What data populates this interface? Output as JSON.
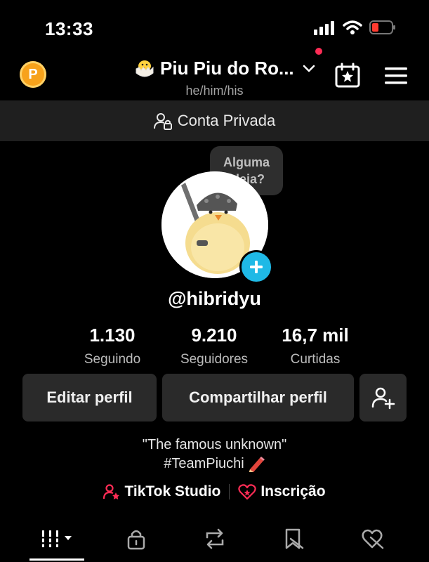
{
  "status_bar": {
    "time": "13:33"
  },
  "header": {
    "coin_letter": "P",
    "account_name": "Piu Piu do Ro...",
    "pronouns": "he/him/his"
  },
  "private_bar": {
    "label": "Conta Privada"
  },
  "avatar": {
    "bubble_line1": "Alguma",
    "bubble_line2": "ideia?"
  },
  "profile": {
    "username": "@hibridyu"
  },
  "stats": [
    {
      "value": "1.130",
      "label": "Seguindo"
    },
    {
      "value": "9.210",
      "label": "Seguidores"
    },
    {
      "value": "16,7 mil",
      "label": "Curtidas"
    }
  ],
  "actions": {
    "edit": "Editar perfil",
    "share": "Compartilhar perfil"
  },
  "bio": {
    "line1": "\"The famous unknown\"",
    "line2": "#TeamPiuchi"
  },
  "links": {
    "studio": "TikTok Studio",
    "subscription": "Inscrição"
  },
  "colors": {
    "accent": "#fe2c55",
    "add_button": "#1fb9e6",
    "coin": "#f7a21b"
  },
  "icons": [
    "signal-icon",
    "wifi-icon",
    "battery-icon",
    "coin-icon",
    "chick-emoji-icon",
    "chevron-down-icon",
    "calendar-star-icon",
    "menu-icon",
    "private-account-icon",
    "plus-icon",
    "add-friend-icon",
    "pencil-emoji-icon",
    "studio-icon",
    "subscription-icon",
    "grid-icon",
    "lock-icon",
    "repost-icon",
    "bookmark-icon",
    "liked-icon"
  ]
}
